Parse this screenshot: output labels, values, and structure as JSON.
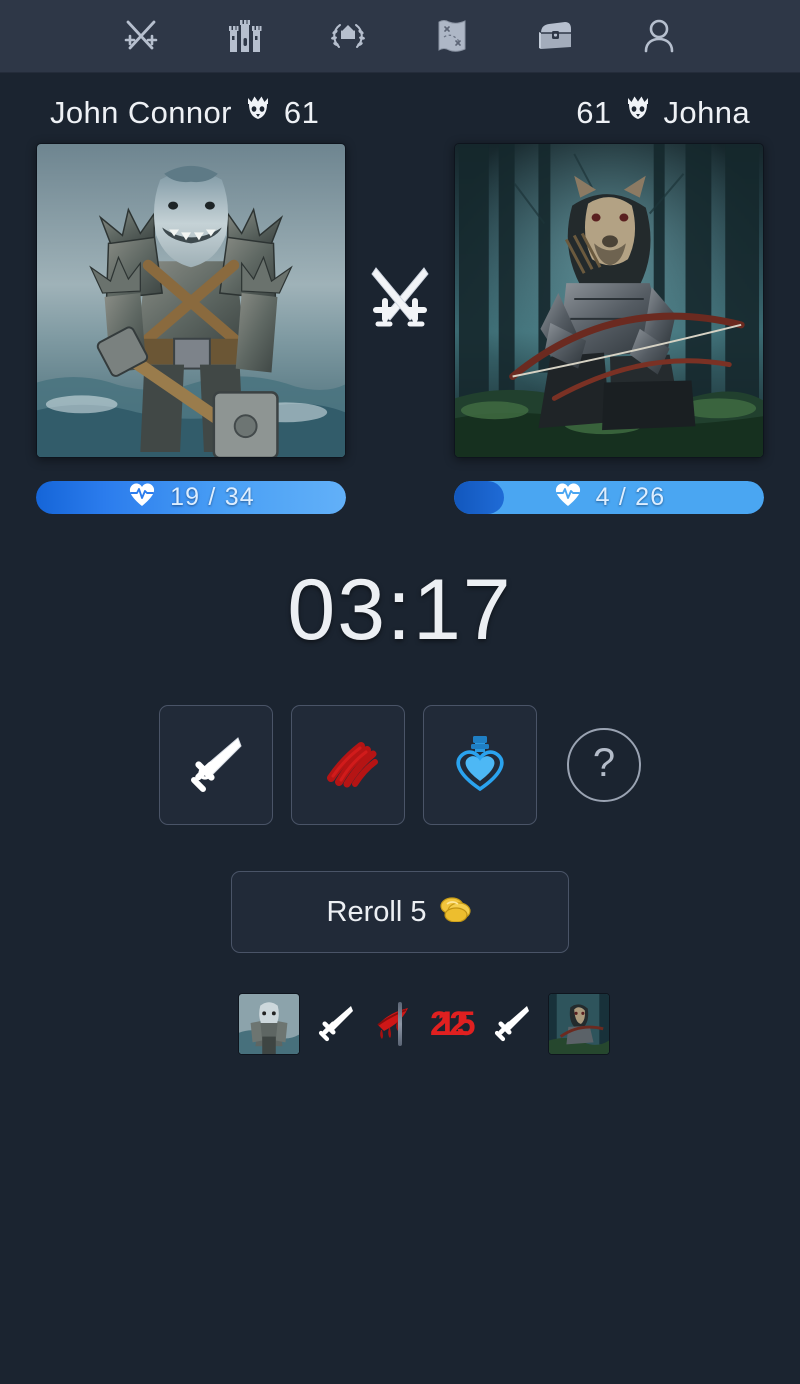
{
  "nav": {
    "items": [
      {
        "icon": "crossed-swords-icon",
        "name": "battle"
      },
      {
        "icon": "castle-icon",
        "name": "castle"
      },
      {
        "icon": "laurel-crown-icon",
        "name": "leaderboard"
      },
      {
        "icon": "treasure-map-icon",
        "name": "map"
      },
      {
        "icon": "treasure-chest-icon",
        "name": "inventory"
      },
      {
        "icon": "user-profile-icon",
        "name": "profile"
      }
    ]
  },
  "battle": {
    "player_left": {
      "name": "John Connor",
      "level": "61",
      "level_icon": "skull-crown-icon",
      "avatar_alt": "armored shark warrior with hammer",
      "hp_current": "19",
      "hp_max": "34",
      "hp_text": "19 / 34",
      "hp_percent": 100
    },
    "player_right": {
      "name": "Johna",
      "level": "61",
      "level_icon": "skull-crown-icon",
      "avatar_alt": "armored capybara archer in forest",
      "hp_current": "4",
      "hp_max": "26",
      "hp_text": "4 / 26",
      "hp_percent": 16
    },
    "vs_icon": "crossed-swords-icon",
    "timer": "03:17"
  },
  "actions": [
    {
      "name": "attack-action",
      "icon": "sword-icon"
    },
    {
      "name": "claw-action",
      "icon": "claw-marks-icon"
    },
    {
      "name": "heal-action",
      "icon": "health-potion-icon"
    }
  ],
  "help": {
    "label": "?",
    "name": "help-button"
  },
  "reroll": {
    "label": "Reroll 5",
    "coin_icon": "gold-coins-icon",
    "cost": "5"
  },
  "log": {
    "left": {
      "sword_icon": "sword-icon",
      "blood_icon": "bloody-slash-icon",
      "damage": "22"
    },
    "right": {
      "sword_icon": "sword-icon",
      "damage": "15"
    }
  },
  "colors": {
    "background": "#1b2430",
    "nav_background": "#2e3747",
    "hp_blue": "#2b7ced",
    "hp_blue_light": "#4aa6f2",
    "damage_red": "#e02020",
    "claw_red": "#b01515",
    "potion_blue": "#2aa3ef",
    "text_light": "#eceff3",
    "border_muted": "#4a5467",
    "gold": "#f2c53d"
  }
}
